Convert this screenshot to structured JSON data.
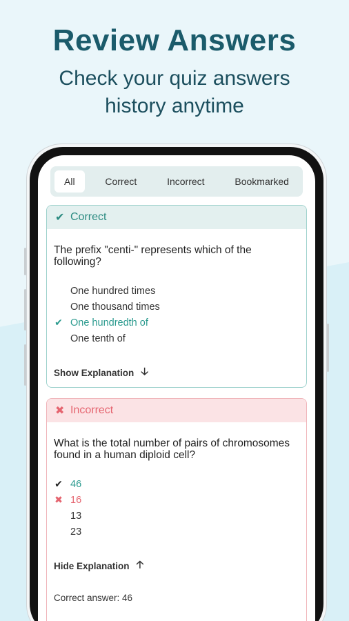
{
  "hero": {
    "title": "Review Answers",
    "subtitle_line1": "Check your quiz answers",
    "subtitle_line2": "history anytime"
  },
  "tabs": [
    {
      "label": "All",
      "active": true
    },
    {
      "label": "Correct",
      "active": false
    },
    {
      "label": "Incorrect",
      "active": false
    },
    {
      "label": "Bookmarked",
      "active": false
    }
  ],
  "cards": [
    {
      "status": "Correct",
      "status_icon": "check-icon",
      "question": "The prefix \"centi-\" represents which of the following?",
      "options": [
        {
          "text": "One hundred times",
          "state": "none"
        },
        {
          "text": "One thousand times",
          "state": "none"
        },
        {
          "text": "One hundredth of",
          "state": "correct"
        },
        {
          "text": "One tenth of",
          "state": "none"
        }
      ],
      "explanation_toggle": "Show Explanation",
      "toggle_icon": "arrow-down-icon"
    },
    {
      "status": "Incorrect",
      "status_icon": "cross-icon",
      "question": "What is the total number of pairs of chromosomes found in a human diploid cell?",
      "options": [
        {
          "text": "46",
          "state": "correct"
        },
        {
          "text": "16",
          "state": "wrong"
        },
        {
          "text": "13",
          "state": "none"
        },
        {
          "text": "23",
          "state": "none"
        }
      ],
      "explanation_toggle": "Hide Explanation",
      "toggle_icon": "arrow-up-icon",
      "correct_answer_text": "Correct answer: 46"
    }
  ],
  "colors": {
    "brand": "#1b5b6b",
    "correct": "#2a9a8e",
    "incorrect": "#e5646f"
  }
}
